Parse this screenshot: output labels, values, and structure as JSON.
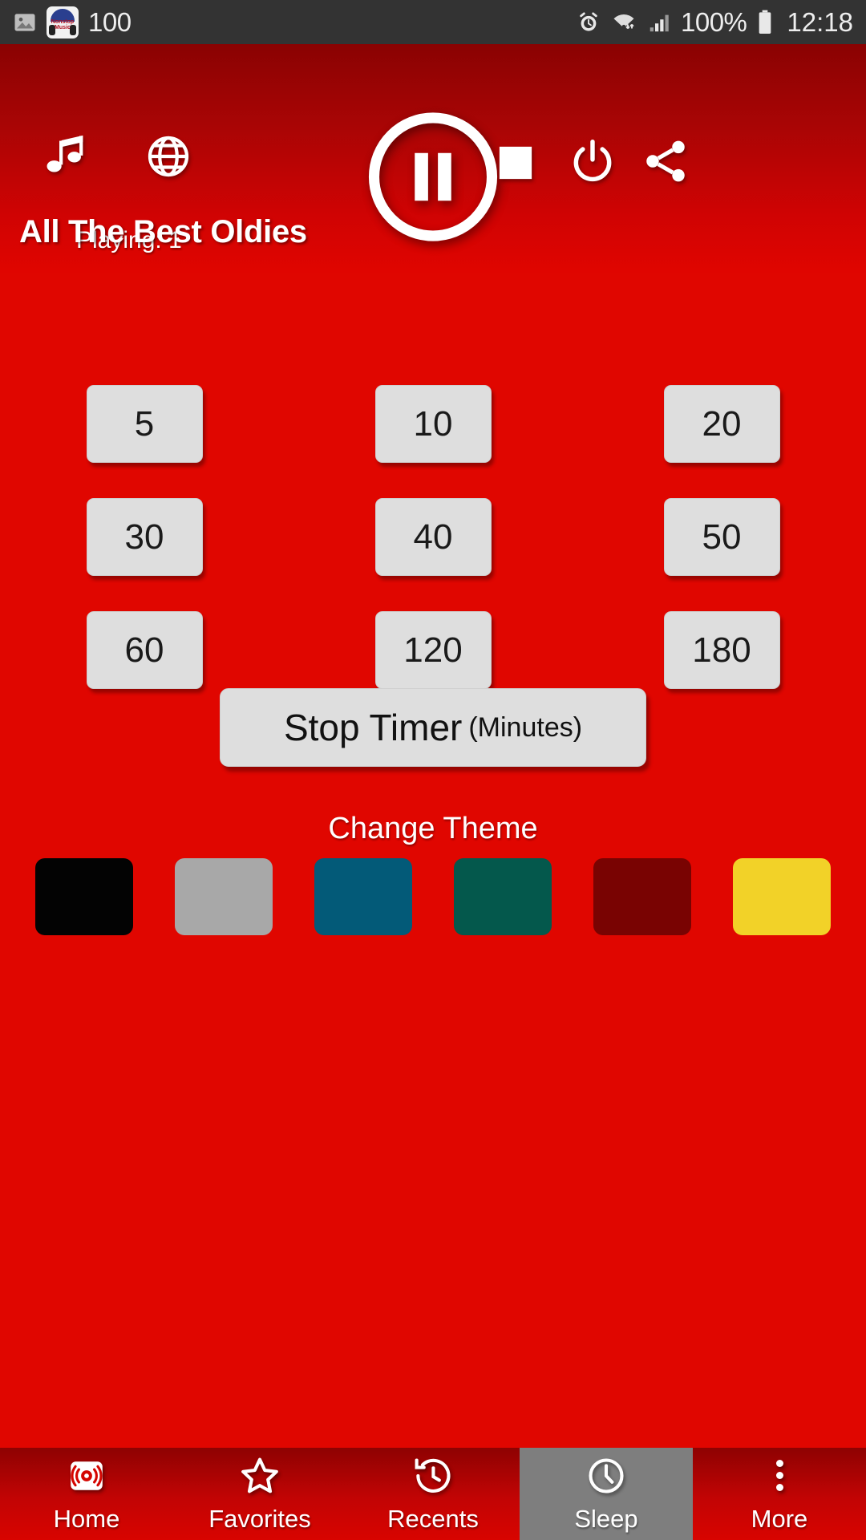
{
  "statusbar": {
    "notification_icons": [
      "image-icon",
      "nonstop-music-app-icon"
    ],
    "app_badge_line1": "Nonstop",
    "app_badge_line2": "Music",
    "notification_count": "100",
    "right_icons": [
      "alarm-icon",
      "wifi-icon",
      "signal-icon"
    ],
    "battery_percent": "100%",
    "time": "12:18"
  },
  "header": {
    "music_icon": "music-note-icon",
    "globe_icon": "globe-icon",
    "play_pause_icon": "pause-icon",
    "stop_icon": "stop-square-icon",
    "power_icon": "power-icon",
    "share_icon": "share-icon",
    "playing_label": "Playing: 1",
    "station_title": "All The Best Oldies"
  },
  "sleep_timer": {
    "buttons": [
      "5",
      "10",
      "20",
      "30",
      "40",
      "50",
      "60",
      "120",
      "180"
    ],
    "stop_timer_label": "Stop Timer",
    "stop_timer_unit": "(Minutes)"
  },
  "theme": {
    "label": "Change Theme",
    "swatches": [
      {
        "name": "black",
        "color": "#030303"
      },
      {
        "name": "gray",
        "color": "#a8a8a8"
      },
      {
        "name": "teal-blue",
        "color": "#035a78"
      },
      {
        "name": "green",
        "color": "#04584c"
      },
      {
        "name": "dark-red",
        "color": "#790302"
      },
      {
        "name": "yellow",
        "color": "#f2d228"
      }
    ]
  },
  "bottom_nav": {
    "items": [
      {
        "label": "Home",
        "icon": "radio-broadcast-icon",
        "active": false
      },
      {
        "label": "Favorites",
        "icon": "star-icon",
        "active": false
      },
      {
        "label": "Recents",
        "icon": "history-clock-icon",
        "active": false
      },
      {
        "label": "Sleep",
        "icon": "clock-icon",
        "active": true
      },
      {
        "label": "More",
        "icon": "more-vertical-icon",
        "active": false
      }
    ]
  },
  "colors": {
    "brand_red": "#e00600",
    "header_dark": "#8a0202",
    "active_nav": "#7e7e7e",
    "button_face": "#dedede"
  }
}
